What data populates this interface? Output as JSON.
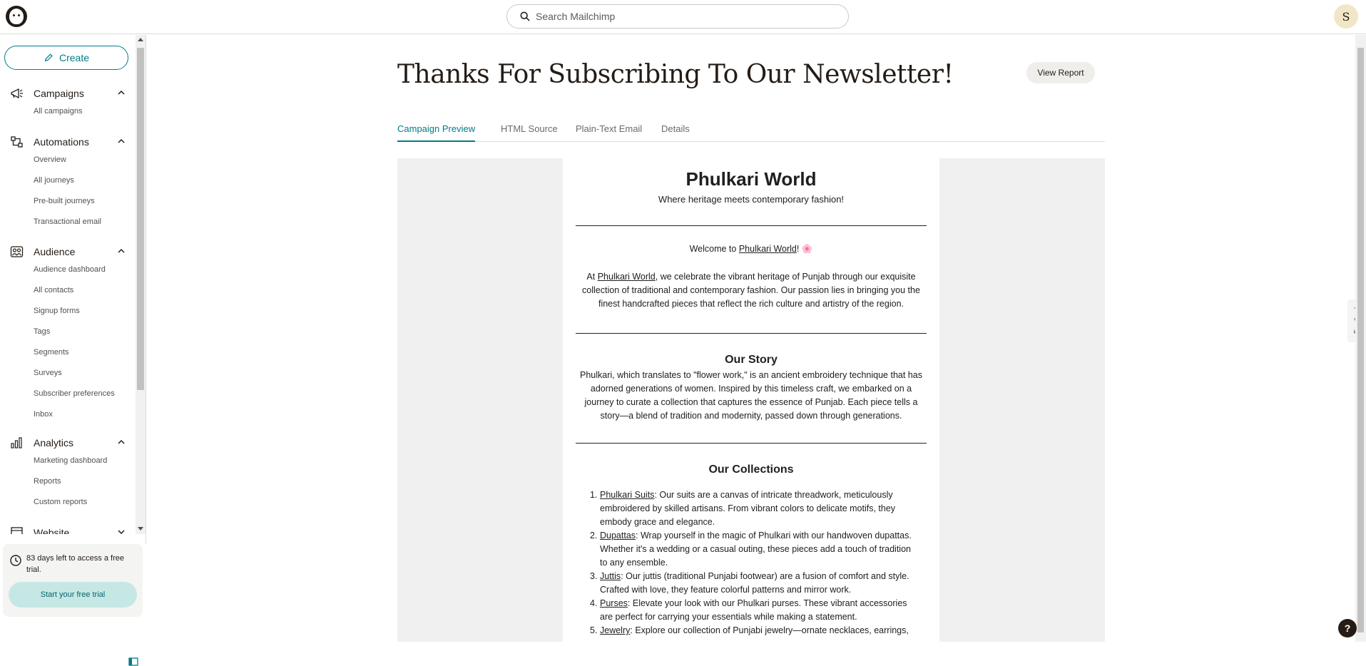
{
  "search": {
    "placeholder": "Search Mailchimp"
  },
  "user": {
    "initial": "S"
  },
  "sidebar": {
    "create_label": "Create",
    "sections": [
      {
        "label": "Campaigns",
        "icon": "megaphone-icon",
        "items": [
          "All campaigns"
        ]
      },
      {
        "label": "Automations",
        "icon": "automation-icon",
        "items": [
          "Overview",
          "All journeys",
          "Pre-built journeys",
          "Transactional email"
        ]
      },
      {
        "label": "Audience",
        "icon": "audience-icon",
        "items": [
          "Audience dashboard",
          "All contacts",
          "Signup forms",
          "Tags",
          "Segments",
          "Surveys",
          "Subscriber preferences",
          "Inbox"
        ]
      },
      {
        "label": "Analytics",
        "icon": "bar-chart-icon",
        "items": [
          "Marketing dashboard",
          "Reports",
          "Custom reports"
        ]
      },
      {
        "label": "Website",
        "icon": "website-icon",
        "items": []
      }
    ],
    "trial_text": "83 days left to access a free trial.",
    "trial_button": "Start your free trial"
  },
  "page": {
    "title": "Thanks For Subscribing To Our Newsletter!",
    "view_report": "View Report",
    "tabs": [
      "Campaign Preview",
      "HTML Source",
      "Plain-Text Email",
      "Details"
    ],
    "active_tab": "Campaign Preview"
  },
  "email": {
    "title": "Phulkari World",
    "tagline": "Where heritage meets contemporary fashion!",
    "welcome_prefix": "Welcome to ",
    "welcome_link": "Phulkari World",
    "welcome_suffix": "! ",
    "welcome_emoji": "🌸",
    "intro_prefix": "At ",
    "intro_link": "Phulkari World",
    "intro_text": ", we celebrate the vibrant heritage of Punjab through our exquisite collection of traditional and contemporary fashion. Our passion lies in bringing you the finest handcrafted pieces that reflect the rich culture and artistry of the region.",
    "story_heading": "Our Story",
    "story_text": "Phulkari, which translates to \"flower work,\" is an ancient embroidery technique that has adorned generations of women. Inspired by this timeless craft, we embarked on a journey to curate a collection that captures the essence of Punjab. Each piece tells a story—a blend of tradition and modernity, passed down through generations.",
    "collections_heading": "Our Collections",
    "collections": [
      {
        "num": "1.",
        "name": "Phulkari Suits",
        "text": ": Our suits are a canvas of intricate threadwork, meticulously embroidered by skilled artisans. From vibrant colors to delicate motifs, they embody grace and elegance."
      },
      {
        "num": "2.",
        "name": "Dupattas",
        "text": ": Wrap yourself in the magic of Phulkari with our handwoven dupattas. Whether it's a wedding or a casual outing, these pieces add a touch of tradition to any ensemble."
      },
      {
        "num": "3.",
        "name": "Juttis",
        "text": ": Our juttis (traditional Punjabi footwear) are a fusion of comfort and style. Crafted with love, they feature colorful patterns and mirror work."
      },
      {
        "num": "4.",
        "name": "Purses",
        "text": ": Elevate your look with our Phulkari purses. These vibrant accessories are perfect for carrying your essentials while making a statement."
      },
      {
        "num": "5.",
        "name": "Jewelry",
        "text": ": Explore our collection of Punjabi jewelry—ornate necklaces, earrings,"
      }
    ]
  },
  "feedback_label": "Feedback",
  "help_label": "?",
  "colors": {
    "accent": "#007c89",
    "trial_button_bg": "#c6e8e4",
    "brand_dark": "#241c15"
  }
}
